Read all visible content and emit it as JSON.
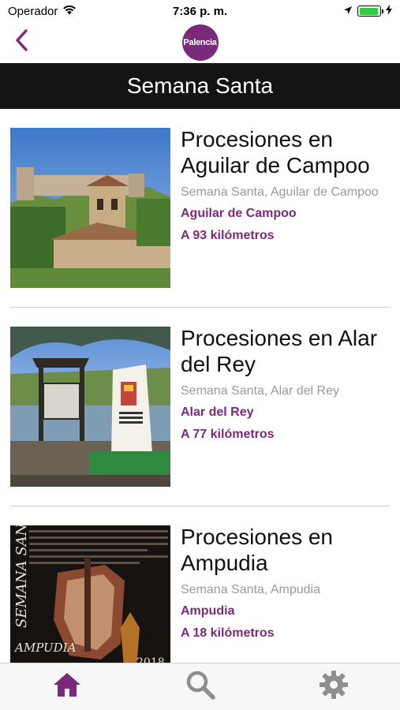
{
  "status_bar": {
    "carrier": "Operador",
    "time": "7:36 p. m.",
    "battery_level": 0.95,
    "icons": [
      "wifi-icon",
      "location-arrow-icon",
      "battery-icon",
      "charging-bolt-icon"
    ]
  },
  "nav": {
    "back_icon": "chevron-left-icon",
    "logo_text": "Palencia",
    "logo_color": "#7b2a7b"
  },
  "header": {
    "title": "Semana Santa"
  },
  "colors": {
    "accent": "#7b2a7b",
    "title_bar": "#141414",
    "muted_text": "#9a9a9a",
    "inactive_tab": "#8e8e8e"
  },
  "items": [
    {
      "title": "Procesiones en Aguilar de Campoo",
      "category": "Semana Santa, Aguilar de Campoo",
      "town": "Aguilar de Campoo",
      "distance": "A 93 kilómetros",
      "image": "castle-church-photo"
    },
    {
      "title": "Procesiones en Alar del Rey",
      "category": "Semana Santa, Alar del Rey",
      "town": "Alar del Rey",
      "distance": "A 77 kilómetros",
      "image": "monument-canal-photo"
    },
    {
      "title": "Procesiones en Ampudia",
      "category": "Semana Santa, Ampudia",
      "town": "Ampudia",
      "distance": "A 18 kilómetros",
      "image": "ampudia-poster",
      "poster_text_side": "SEMANA SAN",
      "poster_text_bottom": "AMPUDIA",
      "poster_year": "2018"
    }
  ],
  "tabs": [
    {
      "name": "home",
      "icon": "home-icon",
      "active": true
    },
    {
      "name": "search",
      "icon": "search-icon",
      "active": false
    },
    {
      "name": "settings",
      "icon": "gear-icon",
      "active": false
    }
  ]
}
